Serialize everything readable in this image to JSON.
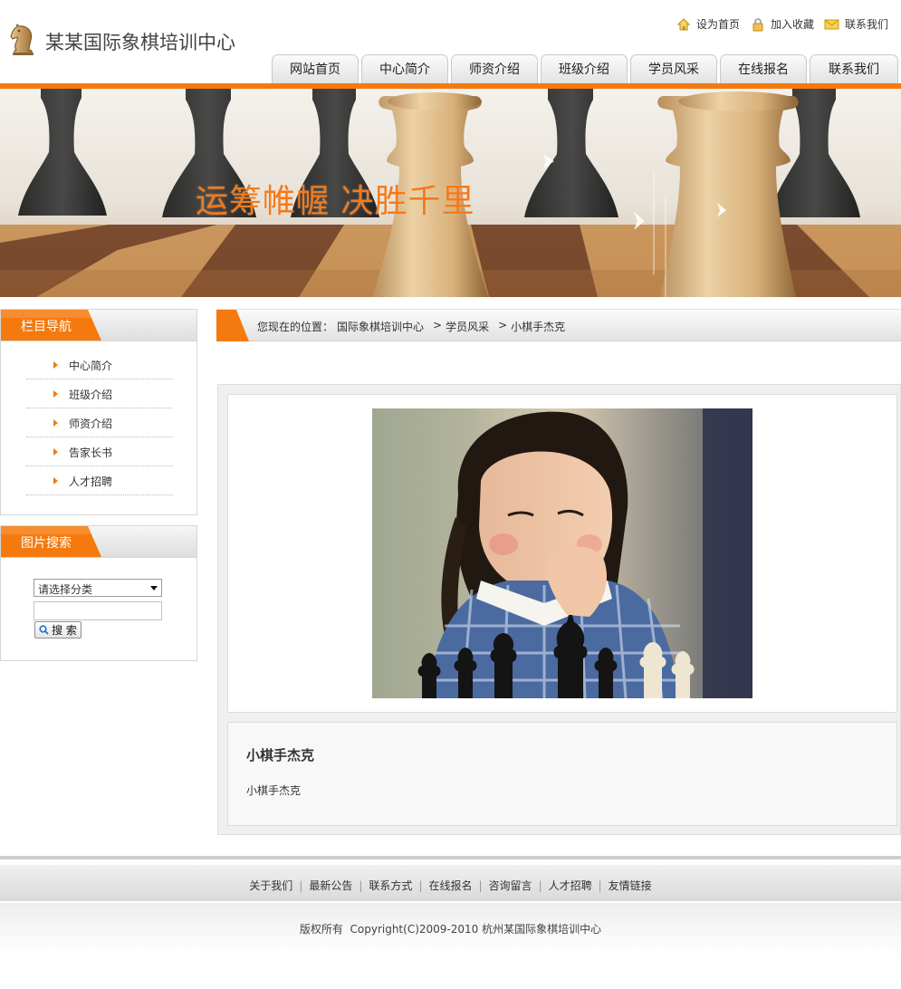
{
  "header": {
    "site_title": "某某国际象棋培训中心",
    "top_links": [
      "设为首页",
      "加入收藏",
      "联系我们"
    ]
  },
  "nav": {
    "tabs": [
      "网站首页",
      "中心简介",
      "师资介绍",
      "班级介绍",
      "学员风采",
      "在线报名",
      "联系我们"
    ]
  },
  "banner": {
    "slogan": "运筹帷幄 决胜千里"
  },
  "sidebar": {
    "nav_title": "栏目导航",
    "nav_items": [
      "中心简介",
      "班级介绍",
      "师资介绍",
      "告家长书",
      "人才招聘"
    ],
    "search_title": "图片搜索",
    "search_select": "请选择分类",
    "search_button": "搜 索"
  },
  "breadcrumb": {
    "prefix": "您现在的位置：",
    "items": [
      "国际象棋培训中心",
      "学员风采",
      "小棋手杰克"
    ],
    "separator": ">"
  },
  "article": {
    "title": "小棋手杰克",
    "description": "小棋手杰克"
  },
  "footer": {
    "links": [
      "关于我们",
      "最新公告",
      "联系方式",
      "在线报名",
      "咨询留言",
      "人才招聘",
      "友情链接"
    ],
    "copyright": "版权所有  Copyright(C)2009-2010 杭州某国际象棋培训中心"
  },
  "colors": {
    "accent": "#f47a0f",
    "nav_bg": "#e2e2e2"
  }
}
